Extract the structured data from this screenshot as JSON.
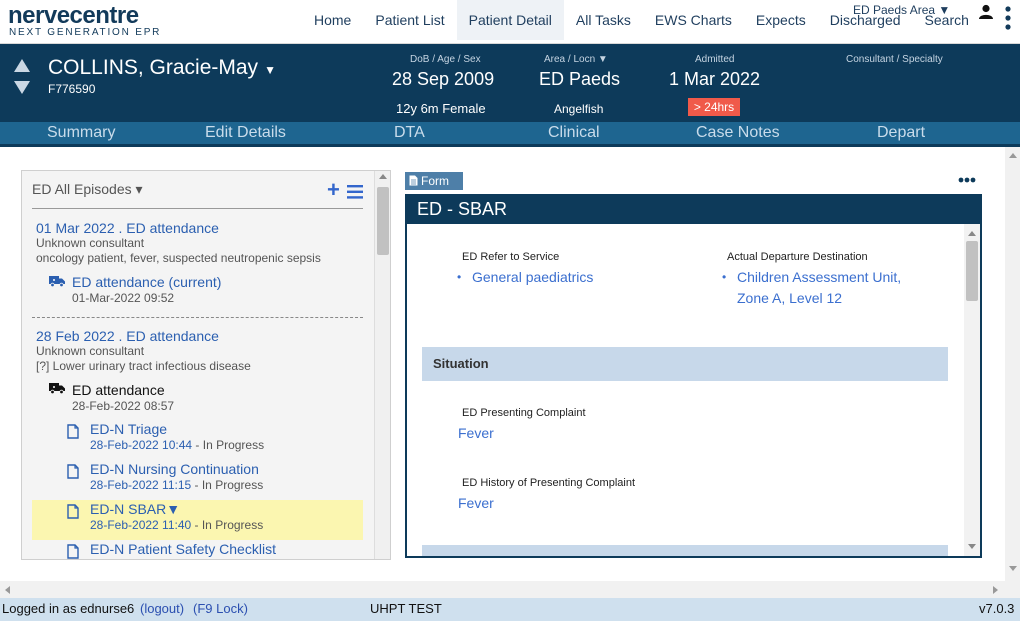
{
  "app": {
    "logo_main": "nervecentre",
    "logo_sub": "NEXT GENERATION EPR",
    "area_selector": "ED Paeds Area ▼"
  },
  "nav": {
    "items": [
      "Home",
      "Patient List",
      "Patient Detail",
      "All Tasks",
      "EWS Charts",
      "Expects",
      "Discharged",
      "Search"
    ],
    "active": "Patient Detail"
  },
  "patient": {
    "name": "COLLINS, Gracie-May",
    "name_caret": "▼",
    "id": "F776590",
    "dob_label": "DoB / Age / Sex",
    "dob": "28 Sep 2009",
    "age_sex": "12y 6m Female",
    "area_label": "Area / Locn ▼",
    "area": "ED Paeds",
    "location": "Angelfish",
    "admitted_label": "Admitted",
    "admitted": "1 Mar 2022",
    "admitted_badge": "> 24hrs",
    "consultant_label": "Consultant / Specialty"
  },
  "subnav": {
    "items": [
      "Summary",
      "Edit Details",
      "DTA",
      "Clinical",
      "Case Notes",
      "Depart"
    ]
  },
  "episodes": {
    "header": "ED All Episodes ▾",
    "add_label": "+",
    "list": [
      {
        "title": "01 Mar 2022 . ED attendance",
        "consultant": "Unknown consultant",
        "reason": "oncology patient, fever, suspected neutropenic sepsis",
        "attendance": {
          "title": "ED attendance (current)",
          "date": "01-Mar-2022 09:52"
        }
      },
      {
        "title": "28 Feb 2022 . ED attendance",
        "consultant": "Unknown consultant",
        "reason": "[?] Lower urinary tract infectious disease",
        "attendance": {
          "title": "ED attendance",
          "date": "28-Feb-2022 08:57"
        },
        "documents": [
          {
            "title": "ED-N Triage",
            "date": "28-Feb-2022 10:44",
            "status": " - In Progress"
          },
          {
            "title": "ED-N Nursing Continuation",
            "date": "28-Feb-2022 11:15",
            "status": " - In Progress"
          },
          {
            "title": "ED-N SBAR▼",
            "date": "28-Feb-2022 11:40",
            "status": " - In Progress"
          },
          {
            "title": "ED-N Patient Safety Checklist",
            "date": "",
            "status": ""
          }
        ]
      }
    ]
  },
  "form": {
    "tab_label": "Form",
    "title": "ED - SBAR",
    "refer_label": "ED Refer to Service",
    "refer_value": "General paediatrics",
    "departure_label": "Actual Departure Destination",
    "departure_value": "Children Assessment Unit, Zone A, Level 12",
    "section_situation": "Situation",
    "complaint_label": "ED Presenting Complaint",
    "complaint_value": "Fever",
    "history_label": "ED History of Presenting Complaint",
    "history_value": "Fever"
  },
  "status_bar": {
    "logged_in": "Logged in as ednurse6",
    "logout": "(logout)",
    "lock": "(F9 Lock)",
    "env": "UHPT TEST",
    "version": "v7.0.3"
  },
  "colors": {
    "banner": "#0d3a5a",
    "subnav": "#1e6590",
    "link": "#2b5fb0",
    "badge": "#f05a4a",
    "highlight": "#fbf6b0",
    "section": "#c7d8ea"
  }
}
